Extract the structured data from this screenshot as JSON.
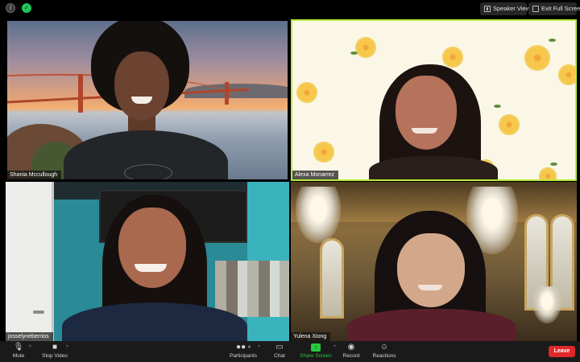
{
  "top_bar": {
    "info_icon": "info-icon",
    "security_icon": "shield-check-icon",
    "speaker_view_label": "Speaker View",
    "exit_fullscreen_label": "Exit Full Screen"
  },
  "participants": [
    {
      "name": "Shania Mccullough",
      "active_speaker": false
    },
    {
      "name": "Alexa Monarrez",
      "active_speaker": true
    },
    {
      "name": "josselyneberrios",
      "active_speaker": false
    },
    {
      "name": "Yulena Xiong",
      "active_speaker": false
    }
  ],
  "toolbar": {
    "mute_label": "Mute",
    "stop_video_label": "Stop Video",
    "participants_label": "Participants",
    "participants_count": "4",
    "chat_label": "Chat",
    "share_screen_label": "Share Screen",
    "record_label": "Record",
    "reactions_label": "Reactions",
    "leave_label": "Leave"
  },
  "colors": {
    "active_speaker_border": "#b6ea3b",
    "share_screen": "#27c93f",
    "leave": "#e02828",
    "toolbar_bg": "#1a1a1a"
  }
}
